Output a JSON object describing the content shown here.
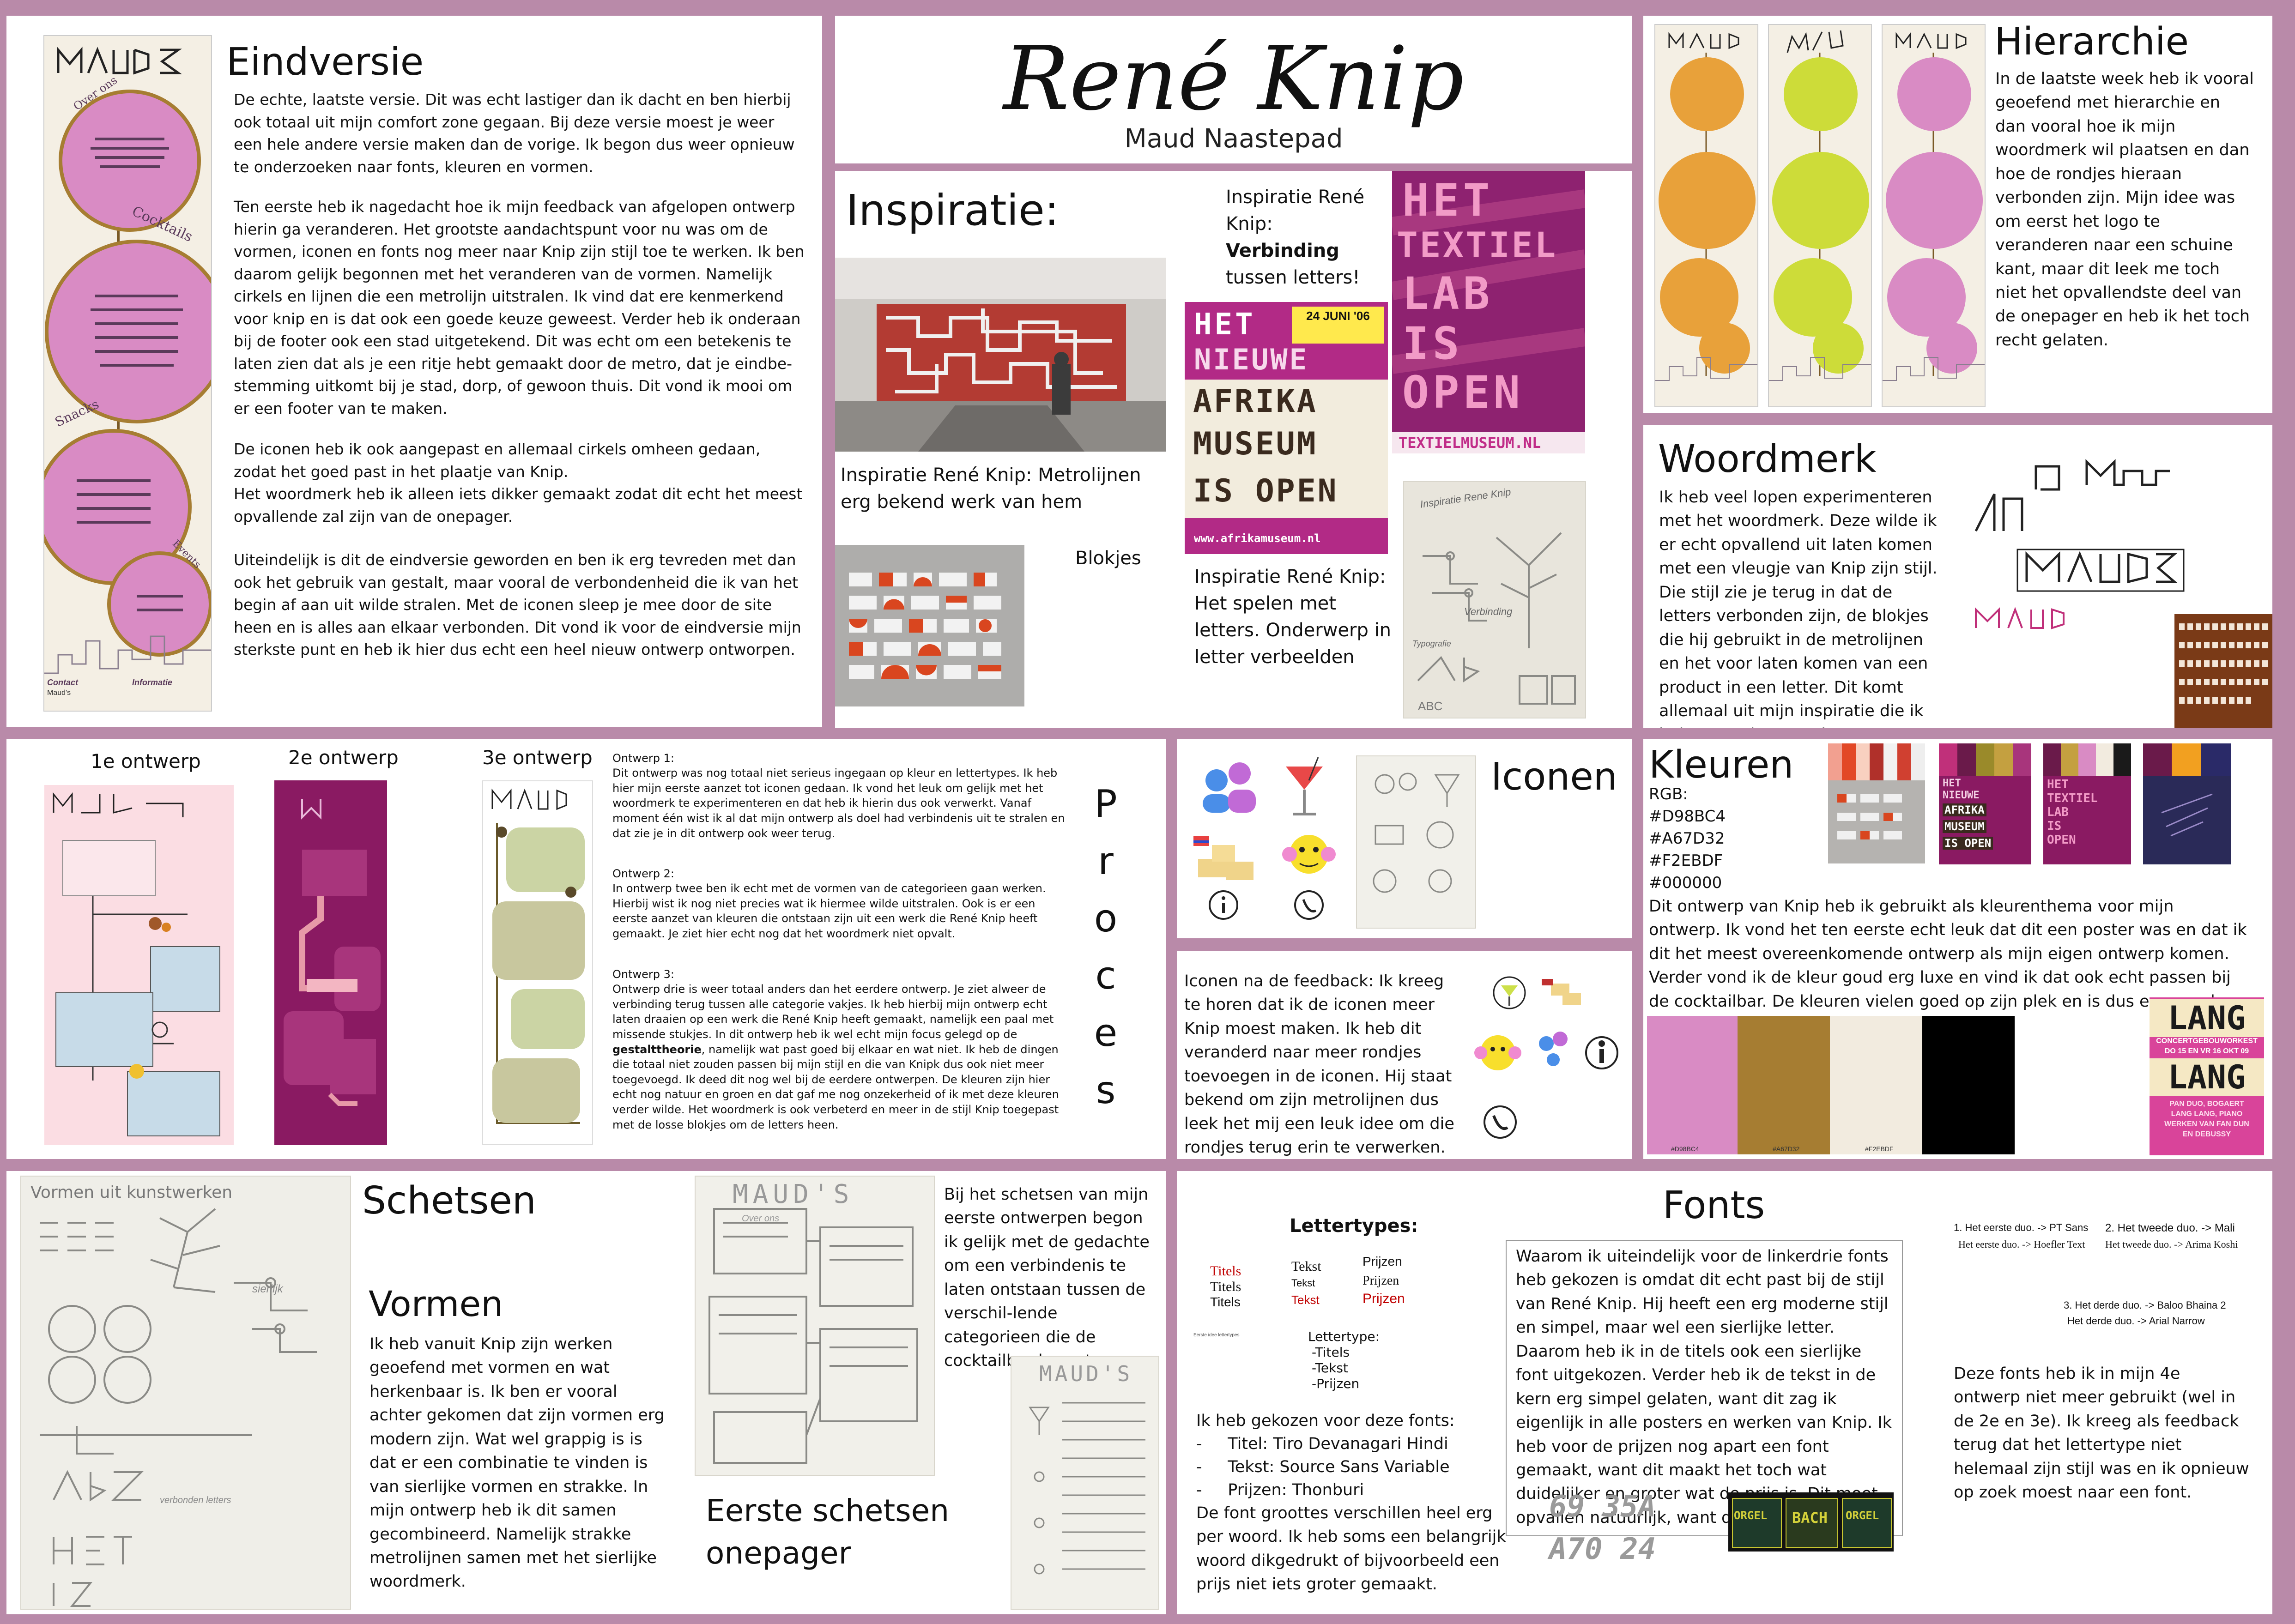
{
  "header": {
    "title": "René Knip",
    "author": "Maud Naastepad"
  },
  "logo_text": "MAUD'S",
  "eindversie": {
    "title": "Eindversie",
    "paragraphs": [
      "De echte, laatste versie. Dit was echt lastiger dan ik dacht en ben hierbij ook totaal uit mijn comfort zone gegaan. Bij deze versie moest je weer een hele andere versie maken dan de vorige. Ik begon dus weer opnieuw te onderzoeken naar fonts, kleuren en vormen.",
      "Ten eerste heb ik nagedacht hoe ik mijn feedback van afgelopen ontwerp hierin ga veranderen. Het grootste aandachtspunt voor nu was om de vormen, iconen en fonts nog meer naar Knip zijn stijl toe te werken. Ik ben daarom gelijk begonnen met het veranderen van de vormen. Namelijk cirkels en lijnen die een metrolijn uitstralen. Ik vind dat ere kenmerkend voor knip en is dat ook een goede keuze geweest. Verder heb ik onderaan bij de footer ook een stad uitgetekend. Dit was echt om een betekenis te laten zien dat als je een ritje hebt gemaakt door de metro, dat je eindbe-stemming uitkomt bij je stad, dorp, of gewoon thuis. Dit vond ik mooi om er een footer van te maken.",
      "De iconen heb ik ook aangepast en allemaal cirkels omheen gedaan, zodat het goed past in het plaatje van Knip.\nHet woordmerk heb ik alleen iets dikker gemaakt zodat dit echt het meest opvallende zal zijn van de onepager.",
      "Uiteindelijk is dit de eindversie geworden en ben ik erg tevreden met dan ook het gebruik van gestalt, maar vooral de verbondenheid die ik van het begin af aan uit wilde stralen. Met de iconen sleep je mee door de site heen en is alles aan elkaar verbonden. Dit vond ik voor de eindversie mijn sterkste punt en heb ik hier dus echt een heel nieuw ontwerp ontworpen."
    ],
    "menu": {
      "sections": [
        "Over ons",
        "Cocktails",
        "Snacks",
        "Events"
      ],
      "footer_left": "Contact",
      "footer_brand": "Maud's",
      "footer_right": "Informatie"
    }
  },
  "inspiratie": {
    "title": "Inspiratie:",
    "caption_metro": "Inspiratie René Knip: Metrolijnen erg bekend werk van hem",
    "caption_blokjes": "Blokjes",
    "caption_verbinding_pre": "Inspiratie René Knip: ",
    "caption_verbinding_bold": "Verbinding",
    "caption_verbinding_post": " tussen letters!",
    "caption_letters": "Inspiratie René Knip: Het spelen met letters. Onderwerp in letter verbeelden",
    "poster_afrika": [
      "HET",
      "NIEUWE",
      "AFRIKA",
      "MUSEUM",
      "IS OPEN"
    ],
    "poster_afrika_date": "24 JUNI '06",
    "poster_afrika_url": "www.afrikamuseum.nl",
    "poster_textiel": [
      "HET",
      "TEXTIEL",
      "LAB",
      "IS",
      "OPEN"
    ],
    "poster_textiel_url": "TEXTIELMUSEUM.NL",
    "sketch_notes": [
      "Inspiratie Rene Knip",
      "Verbinding",
      "Typografie",
      "ABC"
    ]
  },
  "hierarchie": {
    "title": "Hierarchie",
    "text": "In de laatste week heb ik vooral geoefend met hierarchie en dan vooral hoe ik mijn woordmerk wil plaatsen en dan hoe de rondjes hieraan verbonden zijn. Mijn idee was om eerst het logo te veranderen naar een schuine kant, maar dit leek me toch niet het opvallendste deel van de onepager en heb ik het toch recht gelaten."
  },
  "woordmerk": {
    "title": "Woordmerk",
    "text": "Ik heb veel lopen experimenteren met het woordmerk. Deze wilde ik er echt opvallend uit laten komen met een vleugje van Knip zijn stijl. Die stijl zie je terug in dat de letters verbonden zijn, de blokjes die hij gebruikt in de metrolijnen en het voor laten komen van een product in een letter. Dit komt allemaal uit mijn inspiratie die ik heb gevonden over hem."
  },
  "proces": {
    "word": "Proces",
    "labels": [
      "1e ontwerp",
      "2e ontwerp",
      "3e ontwerp"
    ],
    "ontwerpen": [
      {
        "heading": "Ontwerp 1:",
        "text": "Dit ontwerp was nog totaal niet serieus ingegaan op kleur en lettertypes. Ik heb hier mijn eerste aanzet tot iconen gedaan. Ik vond het leuk om gelijk met het woordmerk te experimenteren en dat heb ik hierin dus ook verwerkt. Vanaf moment één wist ik al dat mijn ontwerp als doel had verbindenis uit te stralen en dat zie je in dit ontwerp ook weer terug."
      },
      {
        "heading": "Ontwerp 2:",
        "text": "In ontwerp twee ben ik echt met de vormen van de categorieen gaan werken. Hierbij wist ik nog niet precies wat ik hiermee wilde uitstralen. Ook is er een eerste aanzet van kleuren die ontstaan zijn uit een werk die René Knip heeft gemaakt. Je ziet hier echt nog dat het woordmerk niet opvalt."
      },
      {
        "heading": "Ontwerp 3:",
        "text_pre": "Ontwerp drie is weer totaal anders dan het eerdere ontwerp. Je ziet alweer de verbinding terug tussen alle categorie vakjes. Ik heb hierbij mijn ontwerp echt laten draaien op een werk die René Knip heeft gemaakt, namelijk een paal met missende stukjes. In dit ontwerp heb ik wel echt mijn focus gelegd op de ",
        "text_bold": "gestalttheorie",
        "text_post": ", namelijk wat past goed bij elkaar en wat niet. Ik heb de dingen die totaal niet zouden passen bij mijn stijl en die van Knipk dus ook niet meer toegevoegd. Ik deed dit nog wel bij de eerdere ontwerpen. De kleuren zijn hier echt nog natuur en groen en dat gaf me nog onzekerheid of ik met deze kleuren verder wilde. Het woordmerk is ook verbeterd en meer in de stijl Knip toegepast met de losse blokjes om de letters heen."
      }
    ]
  },
  "iconen": {
    "title": "Iconen",
    "feedback": "Iconen na de feedback: Ik kreeg te horen dat ik de iconen meer Knip moest maken. Ik heb dit veranderd naar meer rondjes toevoegen in de iconen. Hij staat bekend om zijn metrolijnen dus leek het mij een leuk idee om die rondjes terug erin te verwerken."
  },
  "kleuren": {
    "title": "Kleuren",
    "rgb_label": "RGB:",
    "codes": [
      "#D98BC4",
      "#A67D32",
      "#F2EBDF",
      "#000000"
    ],
    "swatch_labels": [
      "#D98BC4",
      "#A67D32",
      "#F2EBDF",
      ""
    ],
    "text": "Dit ontwerp van Knip heb ik gebruikt als kleurenthema voor mijn ontwerp. Ik vond het ten eerste echt leuk dat dit een poster was en dat ik dit het meest overeenkomende ontwerp als mijn eigen ontwerp komen. Verder vond ik de kleur goud erg luxe en vind ik dat ook echt passen bij de cocktailbar. De kleuren vielen goed op zijn plek en is dus een goede combinatie geworden.",
    "poster_lang": [
      "LANG",
      "CONCERTGEBOUWORKEST",
      "DO 15 EN VR 16 OKT 09",
      "LANG",
      "PAN DUO, BOGAERT",
      "LANG LANG, PIANO",
      "WERKEN VAN FAN DUN",
      "EN DEBUSSY"
    ],
    "poster_mini_afrika": [
      "HET",
      "NIEUWE",
      "AFRIKA",
      "MUSEUM",
      "IS OPEN"
    ],
    "poster_mini_textiel": [
      "HET",
      "TEXTIEL",
      "LAB",
      "IS",
      "OPEN"
    ],
    "colors": {
      "pink": "#D98BC4",
      "gold": "#A67D32",
      "cream": "#F2EBDF",
      "black": "#000000",
      "frame": "#B98AA9"
    }
  },
  "schetsen": {
    "title": "Schetsen",
    "vormen_title": "Vormen",
    "vormen_text": "Ik heb vanuit Knip zijn werken geoefend met vormen en wat herkenbaar is. Ik ben er vooral achter gekomen dat zijn vormen erg modern zijn. Wat wel grappig is is dat er een combinatie te vinden is van sierlijke vormen en strakke. In mijn ontwerp heb ik dit samen gecombineerd. Namelijk strakke metrolijnen samen met het sierlijke woordmerk.",
    "sketch_title": "Vormen uit kunstwerken",
    "sketch_words": [
      "sierlijk",
      "verbonden letters"
    ],
    "onepager_text": "Bij het schetsen van mijn eerste ontwerpen begon ik gelijk met de gedachte om een verbindenis te laten ontstaan tussen de verschil-lende categorieen die de cocktailbar brengt.",
    "eerste_title": "Eerste schetsen onepager",
    "sketch_logo": "MAUD'S",
    "sketch_sub": "Over ons"
  },
  "fonts": {
    "title": "Fonts",
    "lettertypes_label": "Lettertypes:",
    "sample_cols": [
      [
        "Titels",
        "Titels",
        "Titels"
      ],
      [
        "Tekst",
        "Tekst",
        "Tekst"
      ],
      [
        "Prijzen",
        "Prijzen",
        "Prijzen"
      ]
    ],
    "small_note": "Eerste idee lettertypes",
    "list_label": "Lettertype:",
    "list_items": [
      "-Titels",
      "-Tekst",
      "-Prijzen"
    ],
    "boxed_text": "Waarom ik uiteindelijk voor de linkerdrie fonts heb gekozen is omdat dit echt past bij de stijl van René Knip. Hij heeft een erg moderne stijl en simpel, maar wel een sierlijke letter. Daarom heb ik in de titels ook een sierlijke font uitgekozen. Verder heb ik de tekst in de kern erg simpel gelaten, want dit zag ik eigenlijk in alle posters en werken van Knip. Ik heb voor de prijzen nog apart een font gemaakt, want dit maakt het toch wat duidelijker en groter wat de prijs is. Dit moet opvallen natuurlijk, want de prijs is erg",
    "chosen_intro": "Ik heb gekozen voor deze fonts:",
    "chosen": [
      "Titel: Tiro Devanagari Hindi",
      "Tekst: Source Sans Variable",
      "Prijzen: Thonburi"
    ],
    "size_text": "De font groottes verschillen heel erg per woord. Ik heb soms een belangrijk woord dikgedrukt of bijvoorbeeld een prijs niet iets groter gemaakt.",
    "duos": [
      {
        "label": "1. Het eerste duo. -> PT Sans",
        "sub": "Het eerste duo. -> Hoefler Text"
      },
      {
        "label": "2. Het tweede duo. -> Mali",
        "sub": "Het tweede duo. -> Arima Koshi"
      },
      {
        "label": "3. Het derde duo. -> Baloo Bhaina 2",
        "sub": "Het derde duo. -> Arial Narrow"
      }
    ],
    "duo_text": "Deze fonts heb ik in mijn 4e ontwerp niet meer gebruikt (wel in de 2e en 3e). Ik kreeg als feedback terug dat het lettertype niet helemaal zijn stijl was en ik opnieuw op zoek moest naar een font.",
    "price_sample": [
      "69 35A",
      "A70 24"
    ],
    "poster_bach": [
      "ORGEL",
      "BACH",
      "ORGEL"
    ]
  }
}
